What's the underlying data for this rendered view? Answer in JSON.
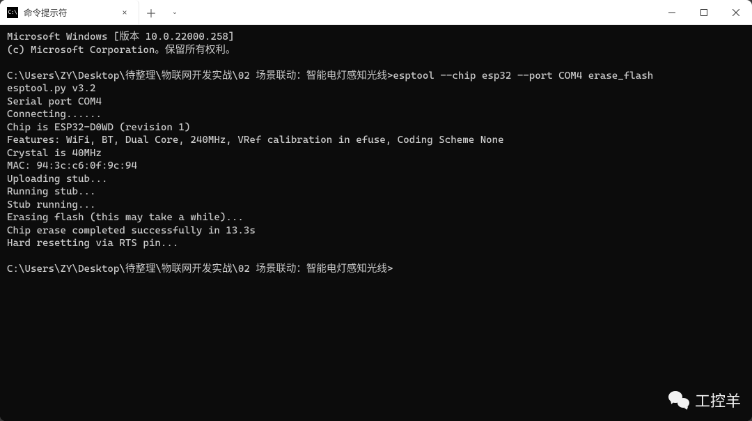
{
  "tab": {
    "icon_text": "C:\\",
    "title": "命令提示符",
    "close": "×"
  },
  "titlebar": {
    "new_tab": "＋",
    "drop": "⌄"
  },
  "terminal": {
    "lines": [
      "Microsoft Windows [版本 10.0.22000.258]",
      "(c) Microsoft Corporation。保留所有权利。",
      "",
      "C:\\Users\\ZY\\Desktop\\待整理\\物联网开发实战\\02 场景联动：智能电灯感知光线>esptool --chip esp32 --port COM4 erase_flash",
      "esptool.py v3.2",
      "Serial port COM4",
      "Connecting......",
      "Chip is ESP32-D0WD (revision 1)",
      "Features: WiFi, BT, Dual Core, 240MHz, VRef calibration in efuse, Coding Scheme None",
      "Crystal is 40MHz",
      "MAC: 94:3c:c6:0f:9c:94",
      "Uploading stub...",
      "Running stub...",
      "Stub running...",
      "Erasing flash (this may take a while)...",
      "Chip erase completed successfully in 13.3s",
      "Hard resetting via RTS pin...",
      "",
      "C:\\Users\\ZY\\Desktop\\待整理\\物联网开发实战\\02 场景联动：智能电灯感知光线>"
    ]
  },
  "watermark": {
    "text": "工控羊"
  }
}
